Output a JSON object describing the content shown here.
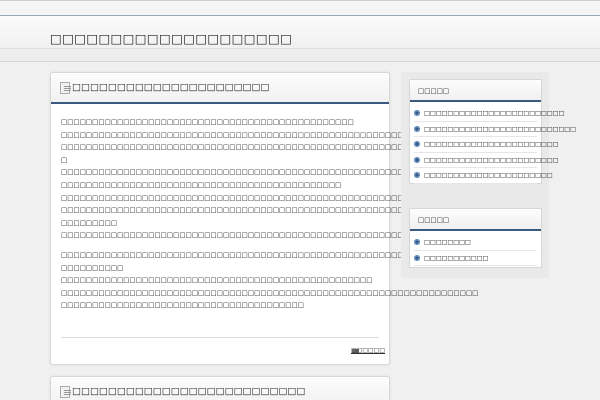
{
  "header": {
    "site_title": "□□□□□□□□□□□□□□□□□□□□"
  },
  "posts": [
    {
      "title": "□□□□□□□□□□□□□□□□□□□□□□",
      "lines": [
        "□□□□□□□□□□□□□□□□□□□□□□□□□□□□□□□□□□□□□□□□□□□□□□□",
        "□□□□□□□□□□□□□□□□□□□□□□□□□□□□□□□□□□□□□□□□□□□□□□□□□□□□□□□□□□□□□□□□□□□□□□□□□□□",
        "□□□□□□□□□□□□□□□□□□□□□□□□□□□□□□□□□□□□□□□□□□□□□□□□□□□□□□□□□□□□□□□□□□□□□□□□□□□□□",
        "□",
        "□□□□□□□□□□□□□□□□□□□□□□□□□□□□□□□□□□□□□□□□□□□□□□□□□□□□□□□□□□□□□□□□□□□□□□□□□□□□□",
        "□□□□□□□□□□□□□□□□□□□□□□□□□□□□□□□□□□□□□□□□□□□□□",
        "□□□□□□□□□□□□□□□□□□□□□□□□□□□□□□□□□□□□□□□□□□□□□□□□□□□□□□□□□□□□□□□□□□□□□□□□□□□□□",
        "□□□□□□□□□□□□□□□□□□□□□□□□□□□□□□□□□□□□□□□□□□□□□□□□□□□□□□□□□□□□□□□□□□□□□□□□□□□□□",
        "□□□□□□□□□",
        "□□□□□□□□□□□□□□□□□□□□□□□□□□□□□□□□□□□□□□□□□□□□□□□□□□□□□□□□"
      ],
      "lines2": [
        "□□□□□□□□□□□□□□□□□□□□□□□□□□□□□□□□□□□□□□□□□□□□□□□□□□□□□□□□□□□□□□□□□□□□□□□□□□□□□",
        "□□□□□□□□□□",
        "□□□□□□□□□□□□□□□□□□□□□□□□□□□□□□□□□□□□□□□□□□□□□□□□□□",
        "□□□□□□□□□□□□□□□□□□□□□□□□□□□□□□□□□□□□□□□□□□□□□□□□□□□□□□□□□□□□□□□□□□□",
        "□□□□□□□□□□□□□□□□□□□□□□□□□□□□□□□□□□□□□□□"
      ],
      "category": "□□□□□□"
    },
    {
      "title": "□□□□□□□□□□□□□□□□□□□□□□□□□□"
    }
  ],
  "sidebar": {
    "widget1": {
      "title": "□□□□□",
      "items": [
        "□□□□□□□□□□□□□□□□□□□□□□□□",
        "□□□□□□□□□□□□□□□□□□□□□□□□□□",
        "□□□□□□□□□□□□□□□□□□□□□□□",
        "□□□□□□□□□□□□□□□□□□□□□□□",
        "□□□□□□□□□□□□□□□□□□□□□□"
      ]
    },
    "widget2": {
      "title": "□□□□□",
      "items": [
        "□□□□□□□□",
        "□□□□□□□□□□□"
      ]
    }
  }
}
